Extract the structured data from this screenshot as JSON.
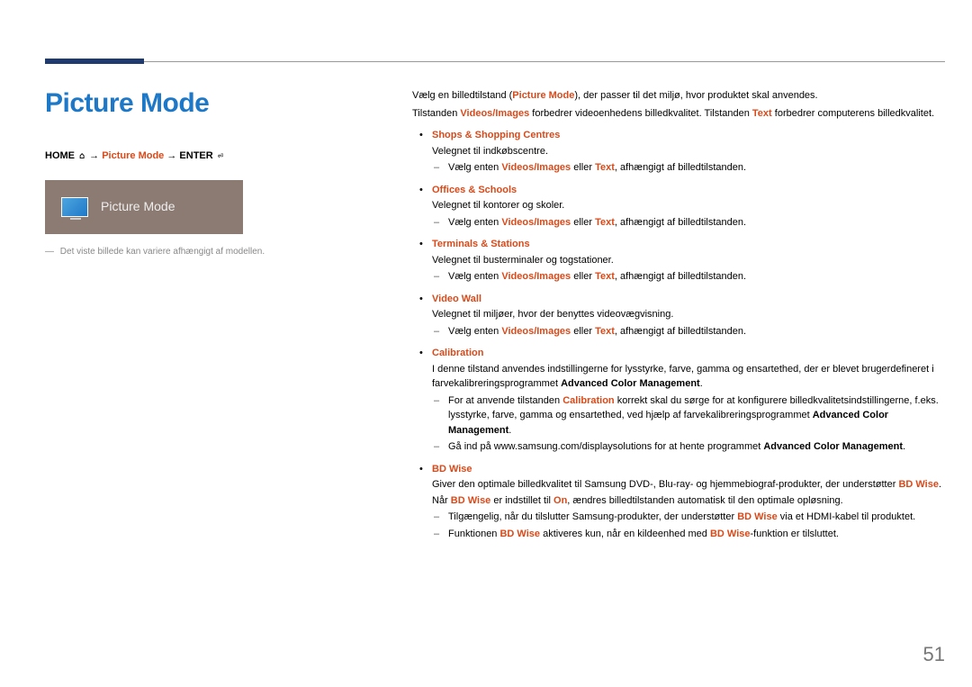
{
  "page": {
    "title": "Picture Mode",
    "number": "51"
  },
  "breadcrumb": {
    "home": "HOME",
    "arrow1": " → ",
    "mode": "Picture Mode",
    "arrow2": " → ",
    "enter": "ENTER",
    "home_icon": "⌂",
    "enter_icon": "⏎"
  },
  "thumb": {
    "label": "Picture Mode"
  },
  "footnote": {
    "dash": "―",
    "text": "Det viste billede kan variere afhængigt af modellen."
  },
  "intro": {
    "line1_a": "Vælg en billedtilstand (",
    "line1_hl": "Picture Mode",
    "line1_b": "), der passer til det miljø, hvor produktet skal anvendes.",
    "line2_a": "Tilstanden ",
    "line2_hl1": "Videos/Images",
    "line2_b": " forbedrer videoenhedens billedkvalitet. Tilstanden ",
    "line2_hl2": "Text",
    "line2_c": " forbedrer computerens billedkvalitet."
  },
  "common_sub": {
    "a": "Vælg enten ",
    "hl1": "Videos/Images",
    "b": " eller ",
    "hl2": "Text",
    "c": ", afhængigt af billedtilstanden."
  },
  "modes": [
    {
      "name": "Shops & Shopping Centres",
      "desc": "Velegnet til indkøbscentre.",
      "has_vi_sub": true
    },
    {
      "name": "Offices & Schools",
      "desc": "Velegnet til kontorer og skoler.",
      "has_vi_sub": true
    },
    {
      "name": "Terminals & Stations",
      "desc": "Velegnet til busterminaler og togstationer.",
      "has_vi_sub": true
    },
    {
      "name": "Video Wall",
      "desc": "Velegnet til miljøer, hvor der benyttes videovægvisning.",
      "has_vi_sub": true
    }
  ],
  "calibration": {
    "name": "Calibration",
    "desc_a": "I denne tilstand anvendes indstillingerne for lysstyrke, farve, gamma og ensartethed, der er blevet brugerdefineret i farvekalibreringsprogrammet ",
    "desc_bold": "Advanced Color Management",
    "desc_b": ".",
    "sub1_a": "For at anvende tilstanden ",
    "sub1_hl": "Calibration",
    "sub1_b": " korrekt skal du sørge for at konfigurere billedkvalitetsindstillingerne, f.eks. lysstyrke, farve, gamma og ensartethed, ved hjælp af farvekalibreringsprogrammet ",
    "sub1_bold": "Advanced Color Management",
    "sub1_c": ".",
    "sub2_a": "Gå ind på www.samsung.com/displaysolutions for at hente programmet ",
    "sub2_bold": "Advanced Color Management",
    "sub2_b": "."
  },
  "bdwise": {
    "name": "BD Wise",
    "desc_a": "Giver den optimale billedkvalitet til Samsung DVD-, Blu-ray- og hjemmebiograf-produkter, der understøtter ",
    "desc_hl": "BD Wise",
    "desc_b": ".",
    "line2_a": "Når ",
    "line2_hl1": "BD Wise",
    "line2_b": " er indstillet til ",
    "line2_hl2": "On",
    "line2_c": ", ændres billedtilstanden automatisk til den optimale opløsning.",
    "sub1_a": "Tilgængelig, når du tilslutter Samsung-produkter, der understøtter ",
    "sub1_hl": "BD Wise",
    "sub1_b": " via et HDMI-kabel til produktet.",
    "sub2_a": "Funktionen ",
    "sub2_hl1": "BD Wise",
    "sub2_b": " aktiveres kun, når en kildeenhed med ",
    "sub2_hl2": "BD Wise",
    "sub2_c": "-funktion er tilsluttet."
  }
}
